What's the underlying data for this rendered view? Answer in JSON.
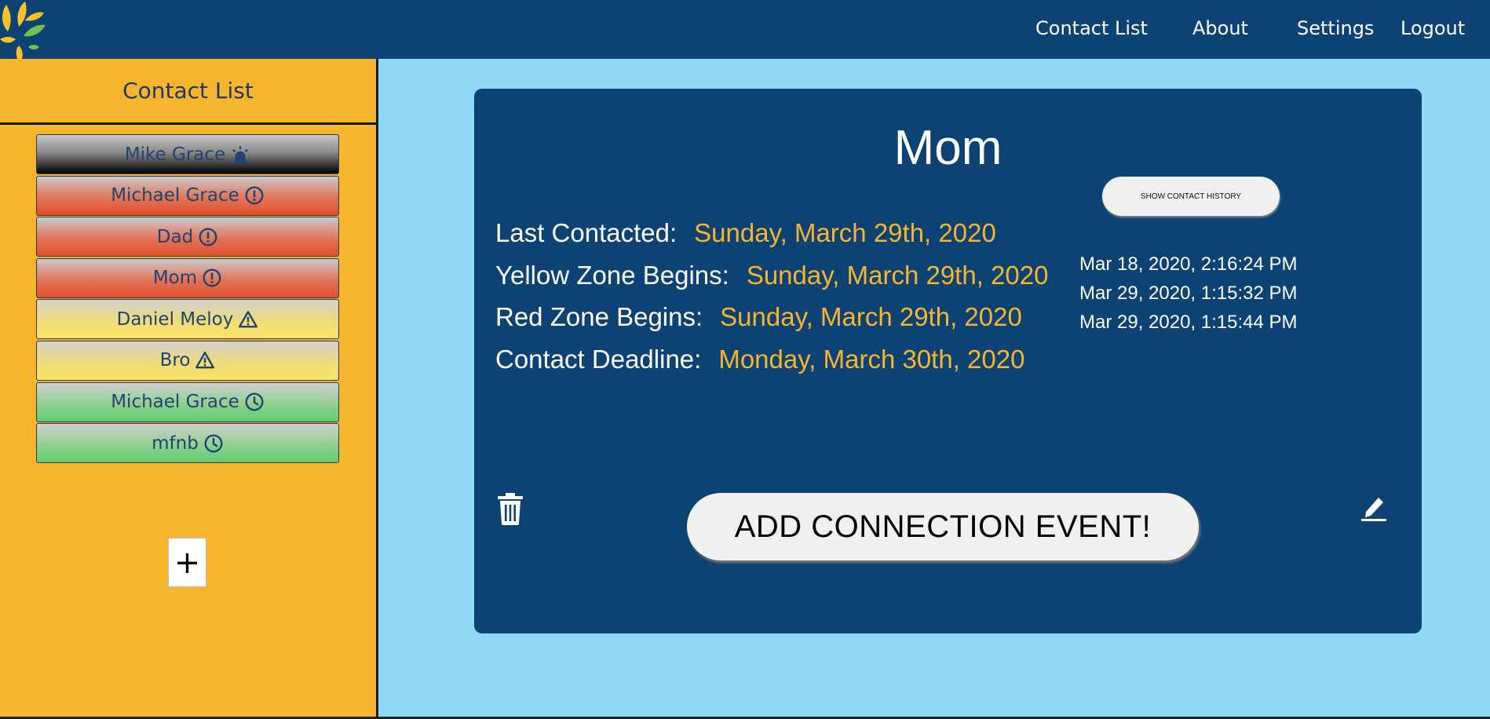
{
  "nav": {
    "links": [
      "Contact List",
      "About",
      "Settings",
      "Logout"
    ]
  },
  "sidebar": {
    "title": "Contact List",
    "contacts": [
      {
        "name": "Mike Grace",
        "status": "overdue",
        "icon": "alarm-icon"
      },
      {
        "name": "Michael Grace",
        "status": "red",
        "icon": "exclamation-circle-icon"
      },
      {
        "name": "Dad",
        "status": "red",
        "icon": "exclamation-circle-icon"
      },
      {
        "name": "Mom",
        "status": "red",
        "icon": "exclamation-circle-icon"
      },
      {
        "name": "Daniel Meloy",
        "status": "yellow",
        "icon": "warning-triangle-icon"
      },
      {
        "name": "Bro",
        "status": "yellow",
        "icon": "warning-triangle-icon"
      },
      {
        "name": "Michael Grace",
        "status": "green",
        "icon": "clock-icon"
      },
      {
        "name": "mfnb",
        "status": "green",
        "icon": "clock-icon"
      }
    ],
    "add_label": "+"
  },
  "card": {
    "name": "Mom",
    "fields": [
      {
        "label": "Last Contacted:",
        "value": "Sunday, March 29th, 2020"
      },
      {
        "label": "Yellow Zone Begins:",
        "value": "Sunday, March 29th, 2020"
      },
      {
        "label": "Red Zone Begins:",
        "value": "Sunday, March 29th, 2020"
      },
      {
        "label": "Contact Deadline:",
        "value": "Monday, March 30th, 2020"
      }
    ],
    "history_button": "SHOW CONTACT HISTORY",
    "history": [
      "Mar 18, 2020, 2:16:24 PM",
      "Mar 29, 2020, 1:15:32 PM",
      "Mar 29, 2020, 1:15:44 PM"
    ],
    "add_event_label": "ADD CONNECTION EVENT!"
  },
  "colors": {
    "nav_bg": "#0d4374",
    "sidebar_bg": "#f6b52c",
    "main_bg": "#8fd9f4",
    "accent_value": "#f6b52c"
  }
}
